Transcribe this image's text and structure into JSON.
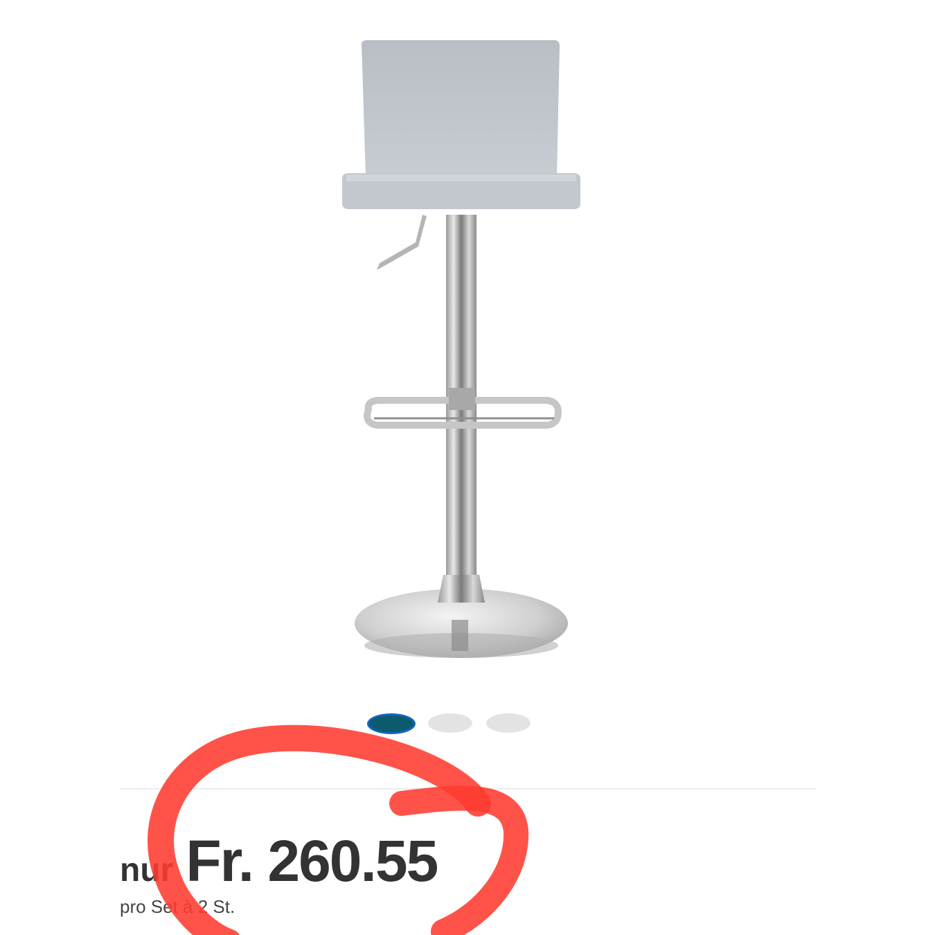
{
  "product": {
    "price_prefix": "nur",
    "price": "Fr. 260.55",
    "unit_note": "pro Set à 2 St."
  },
  "carousel": {
    "count": 3,
    "active_index": 0
  },
  "colors": {
    "active_dot": "#0d5a6e",
    "active_dot_border": "#1565c0",
    "inactive_dot": "#e3e3e3",
    "price_text": "#333333",
    "annotation": "#ff3b30"
  },
  "icons": {
    "annotation": "red-circle-scribble"
  }
}
